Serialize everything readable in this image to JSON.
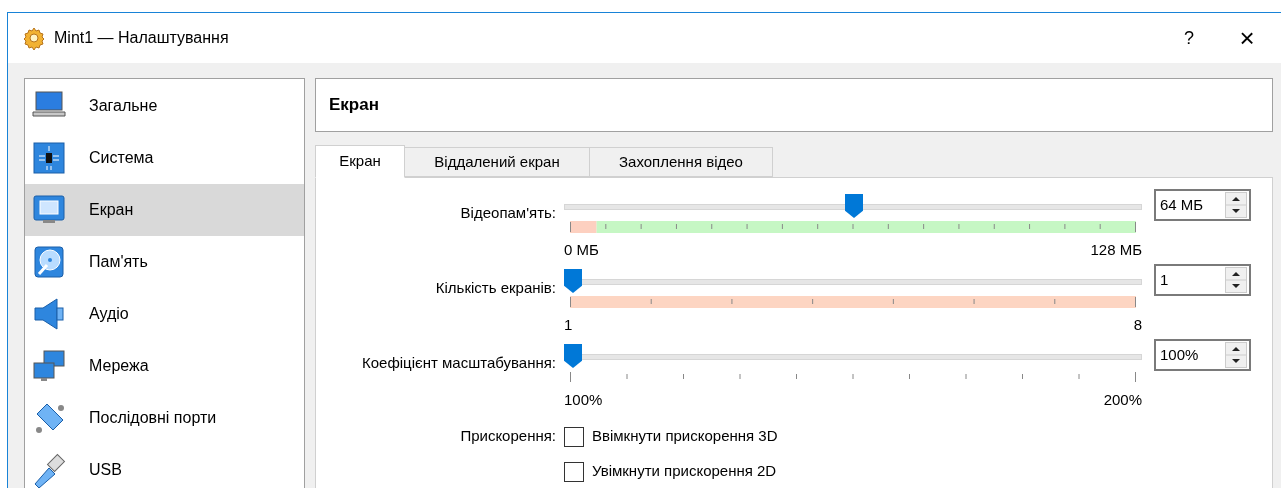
{
  "window": {
    "title": "Mint1 — Налаштування",
    "help": "?",
    "close": "×"
  },
  "sidebar": {
    "items": [
      {
        "label": "Загальне",
        "selected": false
      },
      {
        "label": "Система",
        "selected": false
      },
      {
        "label": "Екран",
        "selected": true
      },
      {
        "label": "Пам'ять",
        "selected": false
      },
      {
        "label": "Аудіо",
        "selected": false
      },
      {
        "label": "Мережа",
        "selected": false
      },
      {
        "label": "Послідовні порти",
        "selected": false
      },
      {
        "label": "USB",
        "selected": false
      }
    ]
  },
  "page_title": "Екран",
  "tabs": [
    {
      "label": "Екран",
      "selected": true
    },
    {
      "label": "Віддалений екран",
      "selected": false
    },
    {
      "label": "Захоплення відео",
      "selected": false
    }
  ],
  "sliders": [
    {
      "kind": "memory",
      "label": "Відеопам'ять:",
      "level": 0.5,
      "min_label": "0 МБ",
      "max_label": "128 МБ",
      "value": "64 МБ"
    },
    {
      "kind": "screens",
      "label": "Кількість екранів:",
      "level": 0,
      "min_label": "1",
      "max_label": "8",
      "value": "1"
    },
    {
      "kind": "plain",
      "label": "Коефіцієнт масштабування:",
      "level": 0,
      "min_label": "100%",
      "max_label": "200%",
      "value": "100%"
    }
  ],
  "acceleration": {
    "label": "Прискорення:",
    "options": [
      {
        "label": "Ввімкнути прискорення 3D",
        "checked": false
      },
      {
        "label": "Увімкнути прискорення 2D",
        "checked": false
      }
    ]
  }
}
